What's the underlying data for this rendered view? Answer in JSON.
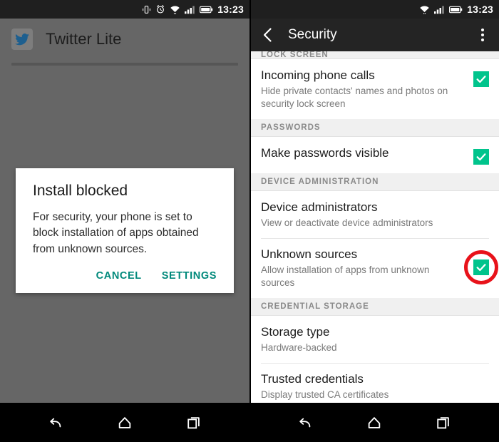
{
  "left_phone": {
    "statusbar": {
      "icons": [
        "vibrate-icon",
        "alarm-icon",
        "wifi-icon",
        "signal-icon",
        "battery-icon"
      ],
      "time": "13:23"
    },
    "app": {
      "icon": "twitter-bird-icon",
      "title": "Twitter Lite"
    },
    "dialog": {
      "title": "Install blocked",
      "message": "For security, your phone is set to block installation of apps obtained from unknown sources.",
      "cancel_label": "CANCEL",
      "settings_label": "SETTINGS",
      "action_color": "#00897b"
    }
  },
  "right_phone": {
    "statusbar": {
      "icons": [
        "wifi-icon",
        "signal-icon",
        "battery-icon"
      ],
      "time": "13:23"
    },
    "header": {
      "back_icon": "back-chevron-icon",
      "title": "Security",
      "overflow_icon": "overflow-menu-icon"
    },
    "sections": [
      {
        "header": "LOCK SCREEN",
        "clipped": true,
        "rows": [
          {
            "title": "Incoming phone calls",
            "subtitle": "Hide private contacts' names and photos on security lock screen",
            "checkbox": true,
            "checked": true,
            "highlighted": false
          }
        ]
      },
      {
        "header": "PASSWORDS",
        "clipped": false,
        "rows": [
          {
            "title": "Make passwords visible",
            "subtitle": "",
            "checkbox": true,
            "checked": true,
            "highlighted": false
          }
        ]
      },
      {
        "header": "DEVICE ADMINISTRATION",
        "clipped": false,
        "rows": [
          {
            "title": "Device administrators",
            "subtitle": "View or deactivate device administrators",
            "checkbox": false,
            "checked": false,
            "highlighted": false
          },
          {
            "title": "Unknown sources",
            "subtitle": "Allow installation of apps from unknown sources",
            "checkbox": true,
            "checked": true,
            "highlighted": true
          }
        ]
      },
      {
        "header": "CREDENTIAL STORAGE",
        "clipped": false,
        "rows": [
          {
            "title": "Storage type",
            "subtitle": "Hardware-backed",
            "checkbox": false,
            "checked": false,
            "highlighted": false
          },
          {
            "title": "Trusted credentials",
            "subtitle": "Display trusted CA certificates",
            "checkbox": false,
            "checked": false,
            "highlighted": false
          }
        ]
      }
    ],
    "annotation": {
      "shape": "circle",
      "color": "#e8121a",
      "target": "unknown-sources-checkbox"
    }
  },
  "navbar": {
    "buttons": [
      "back-icon",
      "home-icon",
      "recents-icon"
    ]
  },
  "colors": {
    "checkbox_green": "#00c48c",
    "dialog_action": "#00897b",
    "annotation_red": "#e8121a",
    "scrim": "#666666",
    "statusbar": "#1f1f1f"
  }
}
